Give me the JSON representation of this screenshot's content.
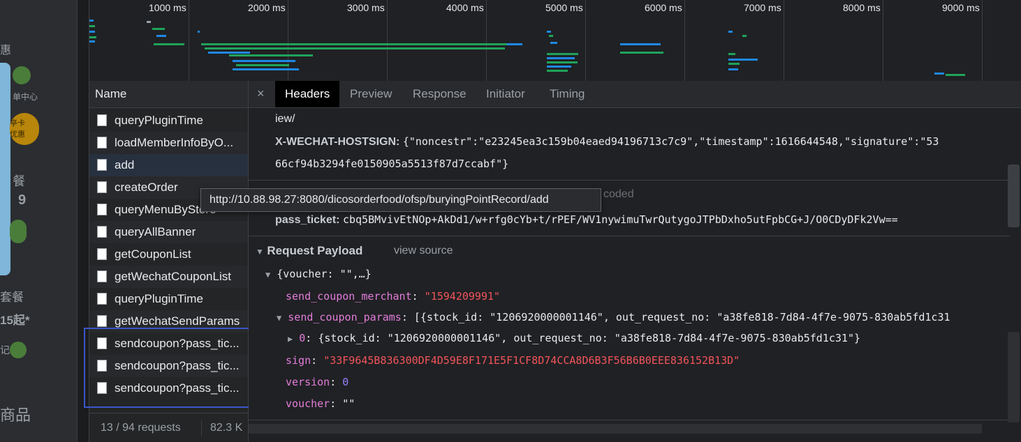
{
  "app_strip": {
    "texts": [
      "惠",
      "单中心",
      "餐",
      "9",
      "套餐",
      "15起*",
      "记",
      "商品",
      "亭卡",
      "优惠"
    ]
  },
  "overview": {
    "ticks": [
      "1000 ms",
      "2000 ms",
      "3000 ms",
      "4000 ms",
      "5000 ms",
      "6000 ms",
      "7000 ms",
      "8000 ms",
      "9000 ms"
    ],
    "colors": {
      "waiting": "#1fa35a",
      "receiving": "#1e88e5",
      "blocked": "#9aa0a6"
    }
  },
  "request_list": {
    "header": "Name",
    "rows": [
      "queryPluginTime",
      "loadMemberInfoByO...",
      "add",
      "createOrder",
      "queryMenuByStore",
      "queryAllBanner",
      "getCouponList",
      "getWechatCouponList",
      "queryPluginTime",
      "getWechatSendParams",
      "sendcoupon?pass_tic...",
      "sendcoupon?pass_tic...",
      "sendcoupon?pass_tic..."
    ],
    "selected_index": 2,
    "status_requests": "13 / 94 requests",
    "status_size": "82.3 K"
  },
  "tooltip": "http://10.88.98.27:8080/dicosorderfood/ofsp/buryingPointRecord/add",
  "detail": {
    "tabs": [
      "Headers",
      "Preview",
      "Response",
      "Initiator",
      "Timing"
    ],
    "active_tab": "Headers",
    "close_symbol": "×",
    "line_iew": "iew/",
    "hostsign_key": "X-WECHAT-HOSTSIGN:",
    "hostsign_val": "{\"noncestr\":\"e23245ea3c159b04eaed94196713c7c9\",\"timestamp\":1616644548,\"signature\":\"53",
    "hostsign_cont": "66cf94b3294fe0150905a5513f87d7ccabf\"}",
    "faded_text": "coded",
    "pass_ticket_key": "pass_ticket:",
    "pass_ticket_val": "cbq5BMvivEtNOp+AkDd1/w+rfg0cYb+t/rPEF/WV1nywimuTwrQutygoJTPbDxho5utFpbCG+J/O0CDyDFk2Vw==",
    "payload_title": "Request Payload",
    "view_source": "view source",
    "voucher_root": "{voucher: \"\",…}",
    "send_coupon_merchant_key": "send_coupon_merchant",
    "send_coupon_merchant_val": "\"1594209991\"",
    "send_coupon_params_key": "send_coupon_params",
    "send_coupon_params_val": "[{stock_id: \"1206920000001146\", out_request_no: \"a38fe818-7d84-4f7e-9075-830ab5fd1c31",
    "item0_key": "0",
    "item0_val": "{stock_id: \"1206920000001146\", out_request_no: \"a38fe818-7d84-4f7e-9075-830ab5fd1c31\"}",
    "sign_key": "sign",
    "sign_val": "\"33F9645B836300DF4D59E8F171E5F1CF8D74CCA8D6B3F56B6B0EEE836152B13D\"",
    "version_key": "version",
    "version_val": "0",
    "voucher_key": "voucher",
    "voucher_val": "\"\""
  }
}
